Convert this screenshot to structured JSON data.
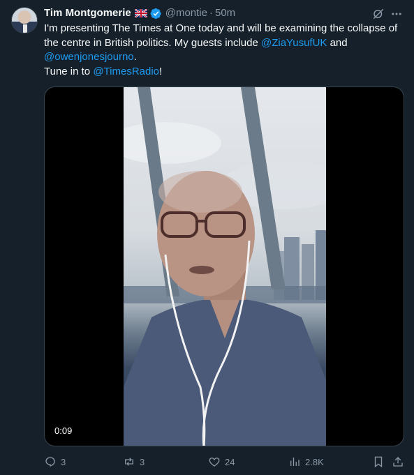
{
  "author": {
    "name": "Tim Montgomerie",
    "handle": "@montie",
    "separator": "·",
    "time": "50m"
  },
  "tweet": {
    "text_part1": "I'm presenting The Times at One today and will be examining the collapse of the centre in British politics. My guests include ",
    "mention1": "@ZiaYusufUK",
    "text_part2": " and ",
    "mention2": "@owenjonesjourno",
    "text_part3": ".",
    "text_part4": "Tune in to ",
    "mention3": "@TimesRadio",
    "text_part5": "!"
  },
  "video": {
    "duration": "0:09"
  },
  "actions": {
    "replies": "3",
    "reposts": "3",
    "likes": "24",
    "views": "2.8K"
  },
  "colors": {
    "background": "#15202b",
    "link": "#1d9bf0",
    "secondary_text": "#8b98a5",
    "verified_badge": "#1d9bf0"
  },
  "icons": {
    "verified": "verified-badge-icon",
    "grok": "grok-icon",
    "more": "more-icon",
    "reply": "reply-icon",
    "repost": "repost-icon",
    "like": "heart-icon",
    "views": "views-icon",
    "bookmark": "bookmark-icon",
    "share": "share-icon"
  }
}
